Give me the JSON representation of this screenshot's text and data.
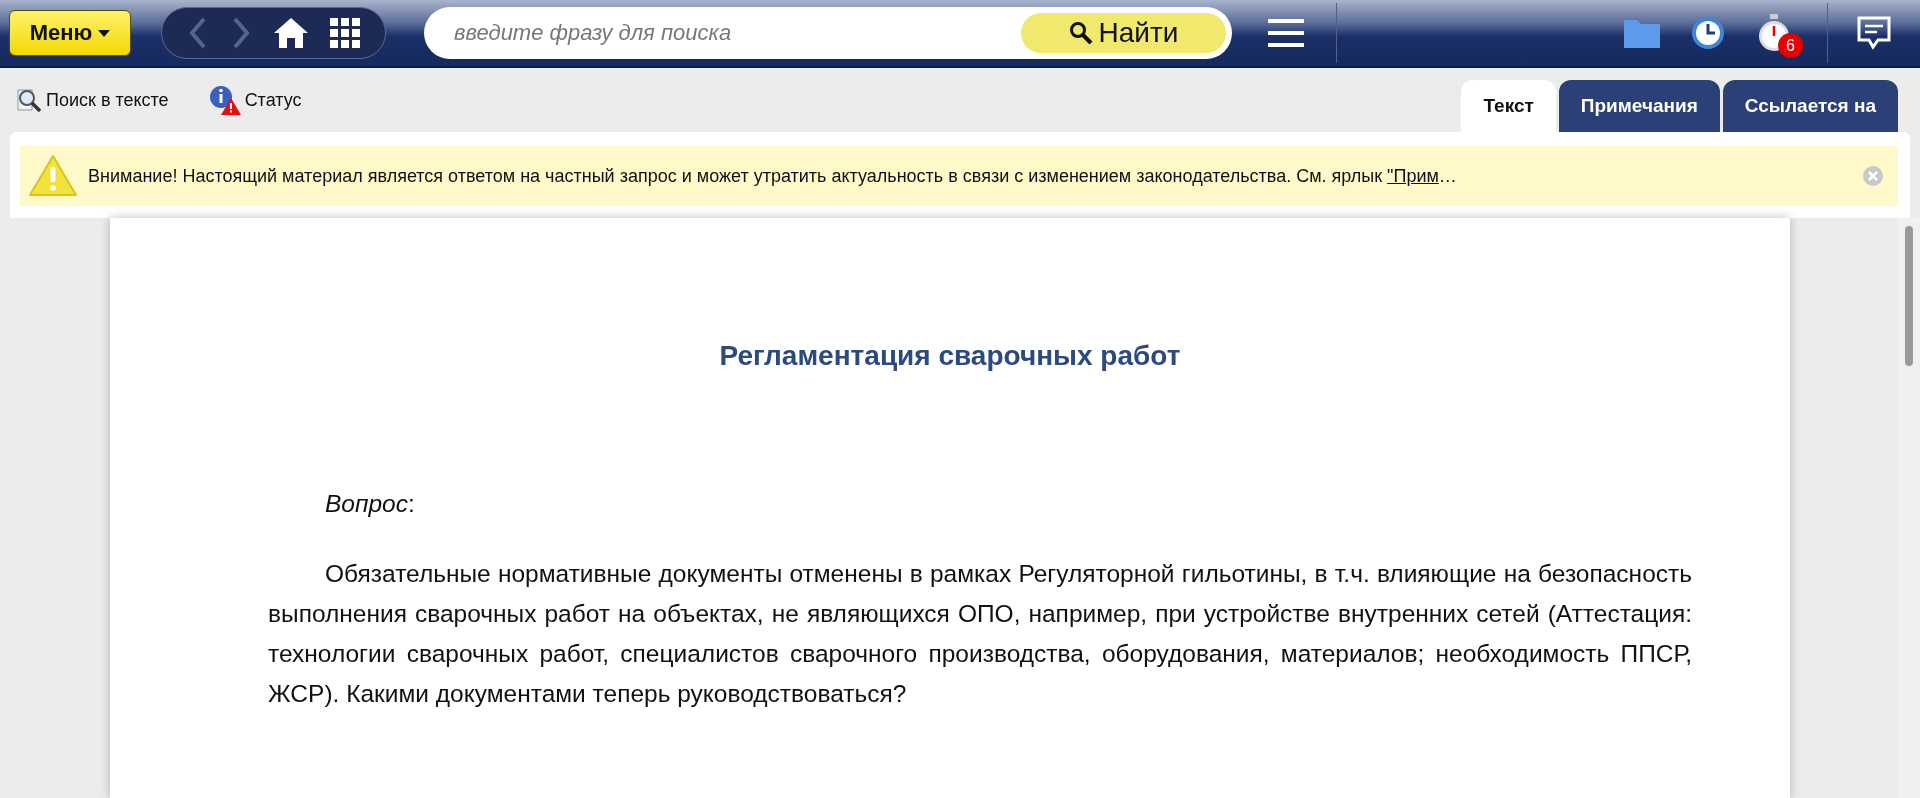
{
  "header": {
    "menu_button": "Меню",
    "search": {
      "placeholder": "введите фразу для поиска"
    },
    "find_button": "Найти",
    "timer_badge": "6"
  },
  "toolbar": {
    "actions": [
      "Поиск в тексте",
      "Статус"
    ]
  },
  "tabs": [
    {
      "label": "Текст",
      "selected": true
    },
    {
      "label": "Примечания",
      "selected": false
    },
    {
      "label": "Ссылается на",
      "selected": false
    }
  ],
  "banner": {
    "text": "Внимание! Настоящий материал является ответом на частный запрос и может утратить актуальность в связи с изменением законодательства. См. ярлык ",
    "link": "\"Прим",
    "ellipsis": "…"
  },
  "document": {
    "title": "Регламентация сварочных работ",
    "paragraphs": [
      "*Вопрос*:",
      "Обязательные нормативные документы отменены в рамках Регуляторной гильотины, в т.ч. влияющие на безопасность выполнения сварочных работ на объектах, не являющихся ОПО, например, при устройстве внутренних сетей (Аттестация: технологии сварочных работ, специалистов сварочного производства, оборудования, материалов; необходимость ППСР, ЖСР). Какими документами теперь руководствоваться?"
    ]
  }
}
